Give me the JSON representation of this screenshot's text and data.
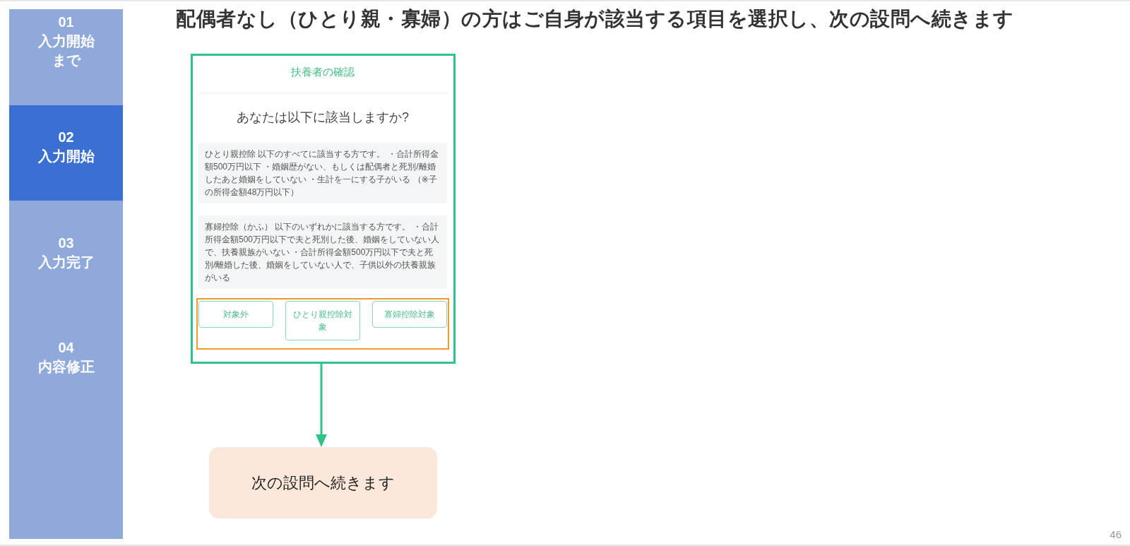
{
  "title": "配偶者なし（ひとり親・寡婦）の方はご自身が該当する項目を選択し、次の設問へ続きます",
  "sidebar": {
    "steps": [
      {
        "number": "01",
        "label": "入力開始まで",
        "selected": false
      },
      {
        "number": "02",
        "label": "入力開始",
        "selected": true
      },
      {
        "number": "03",
        "label": "入力完了",
        "selected": false
      },
      {
        "number": "04",
        "label": "内容修正",
        "selected": false
      }
    ]
  },
  "screen": {
    "header": "扶養者の確認",
    "question": "あなたは以下に該当しますか?",
    "options": [
      {
        "text": "ひとり親控除 以下のすべてに該当する方です。 ・合計所得金額500万円以下 ・婚姻歴がない、もしくは配偶者と死別/離婚したあと婚姻をしていない ・生計を一にする子がいる （※子の所得金額48万円以下）"
      },
      {
        "text": "寡婦控除（かふ） 以下のいずれかに該当する方です。 ・合計所得金額500万円以下で夫と死別した後、婚姻をしていない人で、扶養親族がいない ・合計所得金額500万円以下で夫と死別/離婚した後、婚姻をしていない人で、子供以外の扶養親族がいる"
      }
    ],
    "buttons": [
      {
        "label": "対象外"
      },
      {
        "label": "ひとり親控除対象"
      },
      {
        "label": "寡婦控除対象"
      }
    ]
  },
  "next_step": {
    "text": "次の設問へ続きます"
  },
  "page_number": "46"
}
